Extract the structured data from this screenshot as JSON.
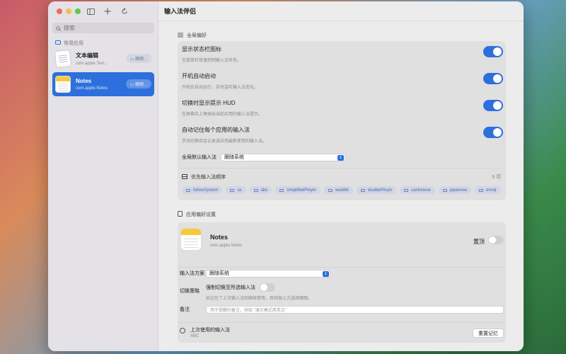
{
  "window_title": "输入法伴侣",
  "sidebar": {
    "search_placeholder": "搜索",
    "section_label": "常用应用",
    "apps": [
      {
        "name": "文本编辑",
        "bundle": "com.apple.Text...",
        "pill": "跟随...",
        "selected": false
      },
      {
        "name": "Notes",
        "bundle": "com.apple.Notes",
        "pill": "跟随...",
        "selected": true
      }
    ]
  },
  "global": {
    "section_title": "全局偏好",
    "settings": [
      {
        "title": "显示状态栏图标",
        "desc": "在菜单栏快速控制输入法伴侣。",
        "on": true
      },
      {
        "title": "开机自动启动",
        "desc": "开机后自动运行，实时监听输入法变化。",
        "on": true
      },
      {
        "title": "切换时显示提示 HUD",
        "desc": "在屏幕右上角弹出当前应用的输入法提示。",
        "on": true
      },
      {
        "title": "自动记住每个应用的输入法",
        "desc": "手动切换后会记录该应用最新使用的输入法。",
        "on": true
      }
    ],
    "default_label": "全局默认输入法",
    "default_value": "跟随系统",
    "order_title": "优先输入法顺序",
    "order_count": "9 项",
    "order_items": [
      "followSystem",
      "us",
      "abc",
      "simplifiedPinyin",
      "wubi86",
      "doublePinyin",
      "cantonese",
      "japanese",
      "emoji"
    ]
  },
  "app_pref": {
    "section_title": "应用偏好设置",
    "app_name": "Notes",
    "bundle": "com.apple.Notes",
    "pin_label": "置顶",
    "pin_on": false,
    "scheme_label": "输入法方案",
    "scheme_value": "跟随系统",
    "strategy_label": "切换策略",
    "force_title": "强制切换至所选输入法",
    "force_desc": "如记住了上次输入法则继续使用，否则按上方选择跟随。",
    "force_on": false,
    "note_label": "备注",
    "note_placeholder": "用于提醒的备注，例如 \"演示模式用英文\""
  },
  "last_used": {
    "title": "上次使用的输入法",
    "value": "ABC",
    "reset_label": "重置记忆"
  },
  "colors": {
    "accent": "#2d6fdc",
    "notes_yellow": "#f7c93a"
  }
}
